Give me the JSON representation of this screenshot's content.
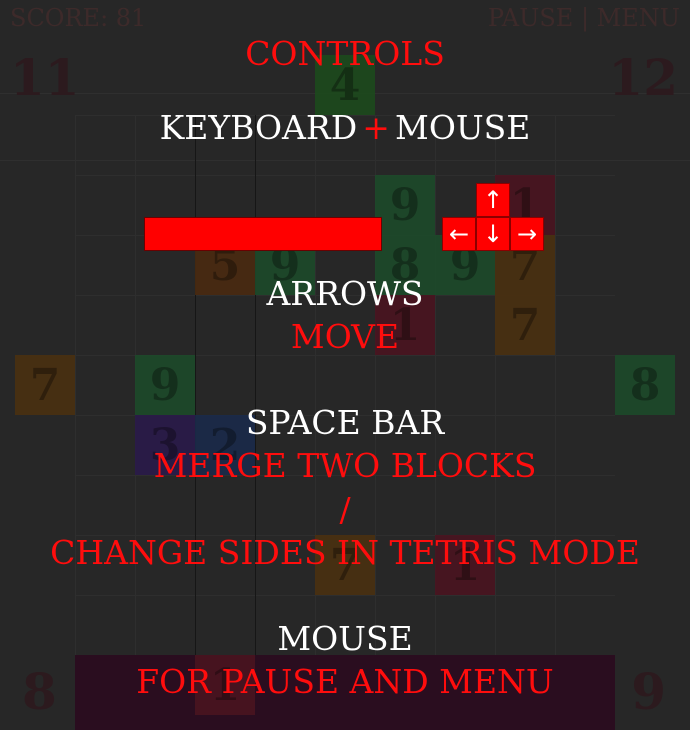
{
  "hud": {
    "score_text": "SCORE: 81",
    "pause_menu_text": "PAUSE | MENU"
  },
  "corners": {
    "top_left": "11",
    "top_right": "12",
    "bottom_left": "8",
    "bottom_right": "9"
  },
  "tiles": [
    {
      "value": "4",
      "color": "#1d4a1d"
    },
    {
      "value": "9",
      "color": "#1d4a2a"
    },
    {
      "value": "1",
      "color": "#4a1420"
    },
    {
      "value": "5",
      "color": "#4a2a10"
    },
    {
      "value": "9",
      "color": "#1d4a2a"
    },
    {
      "value": "8",
      "color": "#1d4a2a"
    },
    {
      "value": "9",
      "color": "#1d4a2a"
    },
    {
      "value": "7",
      "color": "#4a3010"
    },
    {
      "value": "1",
      "color": "#4a1420"
    },
    {
      "value": "7",
      "color": "#4a3010"
    },
    {
      "value": "7",
      "color": "#4a3010"
    },
    {
      "value": "9",
      "color": "#1d4a2a"
    },
    {
      "value": "8",
      "color": "#1d4a2a"
    },
    {
      "value": "3",
      "color": "#2a1a4a"
    },
    {
      "value": "2",
      "color": "#1a2a4a"
    },
    {
      "value": "7",
      "color": "#4a3010"
    },
    {
      "value": "1",
      "color": "#4a1420"
    },
    {
      "value": "1",
      "color": "#4a1420"
    }
  ],
  "controls": {
    "title": "CONTROLS",
    "input_keyboard": "KEYBOARD",
    "input_plus": "+",
    "input_mouse": "MOUSE",
    "arrow_up": "↑",
    "arrow_left": "←",
    "arrow_down": "↓",
    "arrow_right": "→",
    "arrows_label": "ARROWS",
    "arrows_action": "MOVE",
    "space_label": "SPACE BAR",
    "space_action_1": "MERGE TWO BLOCKS",
    "space_action_sep": "/",
    "space_action_2": "CHANGE SIDES IN TETRIS MODE",
    "mouse_label": "MOUSE",
    "mouse_action": "FOR PAUSE AND MENU"
  },
  "colors": {
    "accent": "#ff0000",
    "background": "#272727"
  }
}
